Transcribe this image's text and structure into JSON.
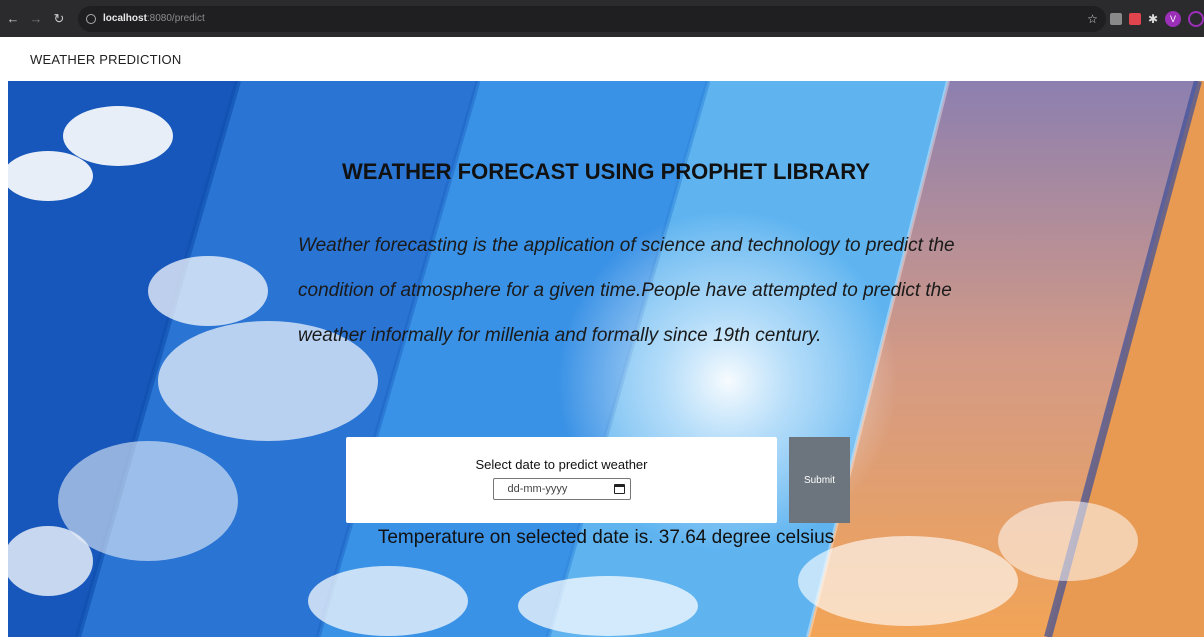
{
  "browser": {
    "url_host": "localhost",
    "url_rest": ":8080/predict",
    "avatar_letter": "V"
  },
  "navbar": {
    "brand": "WEATHER PREDICTION"
  },
  "hero": {
    "title": "WEATHER FORECAST USING PROPHET LIBRARY",
    "description": "Weather forecasting is the application of science and technology to predict the condition of atmosphere for a given time.People have attempted to predict the weather informally for millenia and formally since 19th century.",
    "form_label": "Select date to predict weather",
    "date_placeholder": "dd-mm-yyyy",
    "submit_label": "Submit",
    "result": "Temperature on selected date is. 37.64 degree celsius"
  },
  "colors": {
    "chrome": "#2b2b2d",
    "submit": "#6c757d",
    "avatar": "#9b2fb8"
  }
}
